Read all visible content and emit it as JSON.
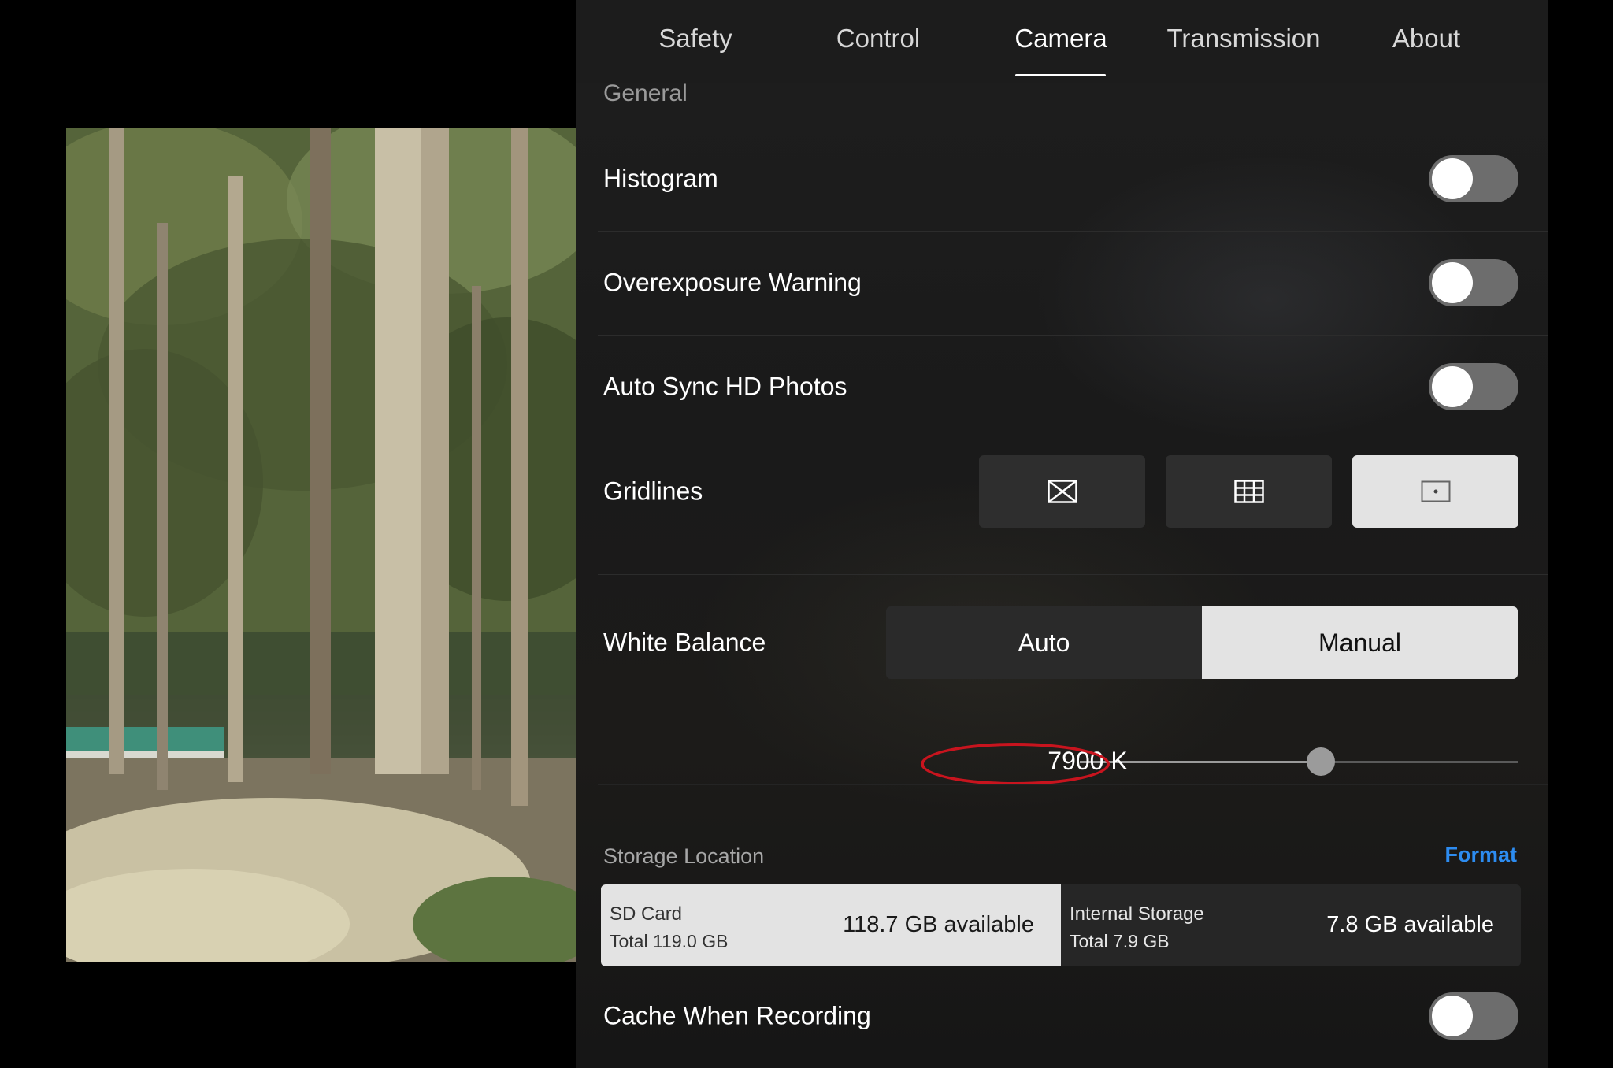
{
  "tabs": [
    {
      "label": "Safety"
    },
    {
      "label": "Control"
    },
    {
      "label": "Camera",
      "active": true
    },
    {
      "label": "Transmission"
    },
    {
      "label": "About"
    }
  ],
  "section": {
    "title": "General"
  },
  "settings": {
    "histogram": {
      "label": "Histogram",
      "enabled": false
    },
    "overexposure": {
      "label": "Overexposure Warning",
      "enabled": false
    },
    "autosync": {
      "label": "Auto Sync HD Photos",
      "enabled": false
    },
    "gridlines": {
      "label": "Gridlines",
      "options": [
        "diagonal-grid-icon",
        "grid-3x3-icon",
        "center-point-icon"
      ],
      "selected": "center-point-icon"
    },
    "white_balance": {
      "label": "White Balance",
      "auto_label": "Auto",
      "manual_label": "Manual",
      "selected": "Manual",
      "value": "7900 K",
      "slider_fraction": 0.55
    },
    "cache": {
      "label": "Cache When Recording",
      "enabled": false
    }
  },
  "storage": {
    "label": "Storage Location",
    "format_label": "Format",
    "sd": {
      "name": "SD Card",
      "total": "Total 119.0 GB",
      "available": "118.7 GB available",
      "selected": true
    },
    "internal": {
      "name": "Internal Storage",
      "total": "Total 7.9 GB",
      "available": "7.8 GB available",
      "selected": false
    }
  },
  "colors": {
    "accent": "#2d8cf0",
    "highlight": "#c8141e",
    "toggle_off": "#6d6d6d"
  }
}
